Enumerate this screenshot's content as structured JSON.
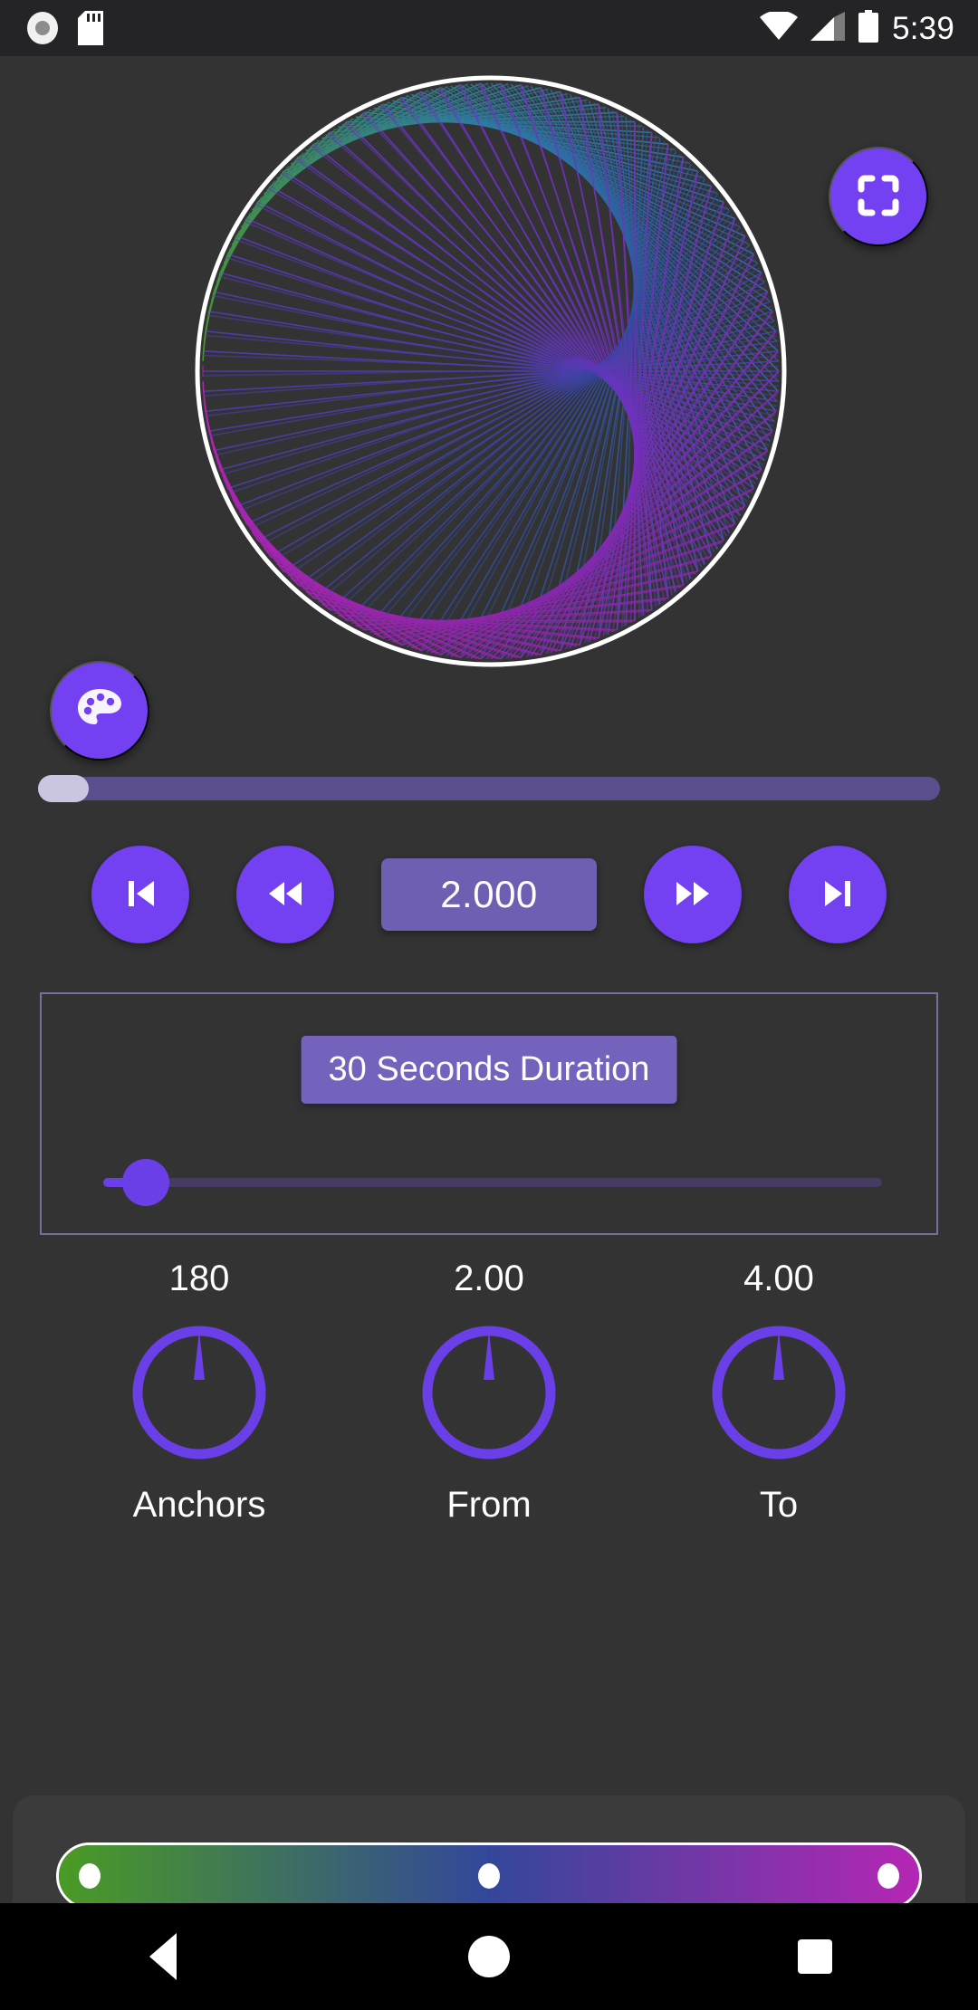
{
  "status_bar": {
    "time": "5:39",
    "icons": [
      "screen-record-icon",
      "sd-card-icon",
      "wifi-icon",
      "cellular-signal-icon",
      "battery-icon"
    ],
    "background": "#242426"
  },
  "theme": {
    "background": "#333333",
    "accent": "#7340f2",
    "accent_muted": "#6e5fb3",
    "panel_border": "#76709e",
    "panel_bottom": "#3b3b3b",
    "text": "#ffffff"
  },
  "canvas": {
    "name": "spirograph-canvas",
    "outline_color": "#ffffff",
    "anchors": 180,
    "multiplier": 2.0,
    "gradient_colors": [
      "#4a9b24",
      "#2e79a8",
      "#33479a",
      "#6a34c0",
      "#8b26a8",
      "#b526b5"
    ]
  },
  "buttons": {
    "fullscreen": "fullscreen-icon",
    "palette": "palette-icon"
  },
  "seek": {
    "name": "playback-seekbar",
    "value_percent": 0,
    "track_color": "#5a4f8c",
    "thumb_color": "#cac5e0"
  },
  "transport": {
    "skip_start_label": "skip-to-start",
    "rewind_label": "rewind",
    "value": "2.000",
    "forward_label": "fast-forward",
    "skip_end_label": "skip-to-end"
  },
  "duration": {
    "chip_label": "30 Seconds Duration",
    "slider_percent": 5.5,
    "slider_fill_color": "#6b3fe8"
  },
  "knobs": [
    {
      "value": "180",
      "label": "Anchors",
      "angle_deg": 0
    },
    {
      "value": "2.00",
      "label": "From",
      "angle_deg": 0
    },
    {
      "value": "4.00",
      "label": "To",
      "angle_deg": 0
    }
  ],
  "gradient_bar": {
    "name": "color-gradient-picker",
    "stops": [
      {
        "position_percent": 0,
        "color": "#4a9b24"
      },
      {
        "position_percent": 50,
        "color": "#33479a"
      },
      {
        "position_percent": 100,
        "color": "#b526b5"
      }
    ],
    "border_color": "#ffffff"
  },
  "nav_bar": {
    "back": "back-triangle-icon",
    "home": "home-circle-icon",
    "recents": "recents-square-icon"
  }
}
